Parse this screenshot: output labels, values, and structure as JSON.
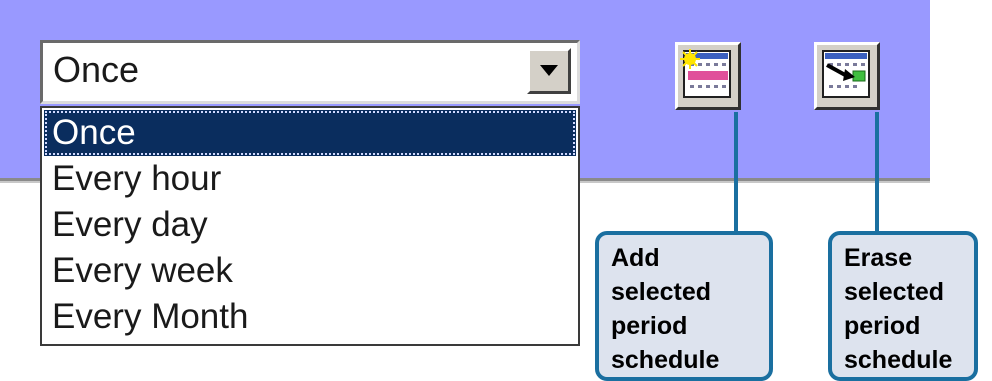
{
  "schedule": {
    "selected_value": "Once",
    "options": [
      "Once",
      "Every hour",
      "Every day",
      "Every week",
      "Every Month"
    ],
    "selected_index": 0
  },
  "toolbar": {
    "add_icon": "calendar-add-icon",
    "erase_icon": "calendar-erase-icon"
  },
  "callouts": {
    "add": [
      "Add",
      "selected",
      "period",
      "schedule"
    ],
    "erase": [
      "Erase",
      "selected",
      "period",
      "schedule"
    ]
  },
  "colors": {
    "panel": "#9999ff",
    "selection": "#0a2d5e",
    "callout_border": "#1a6fa0",
    "callout_fill": "#dde3ee"
  }
}
